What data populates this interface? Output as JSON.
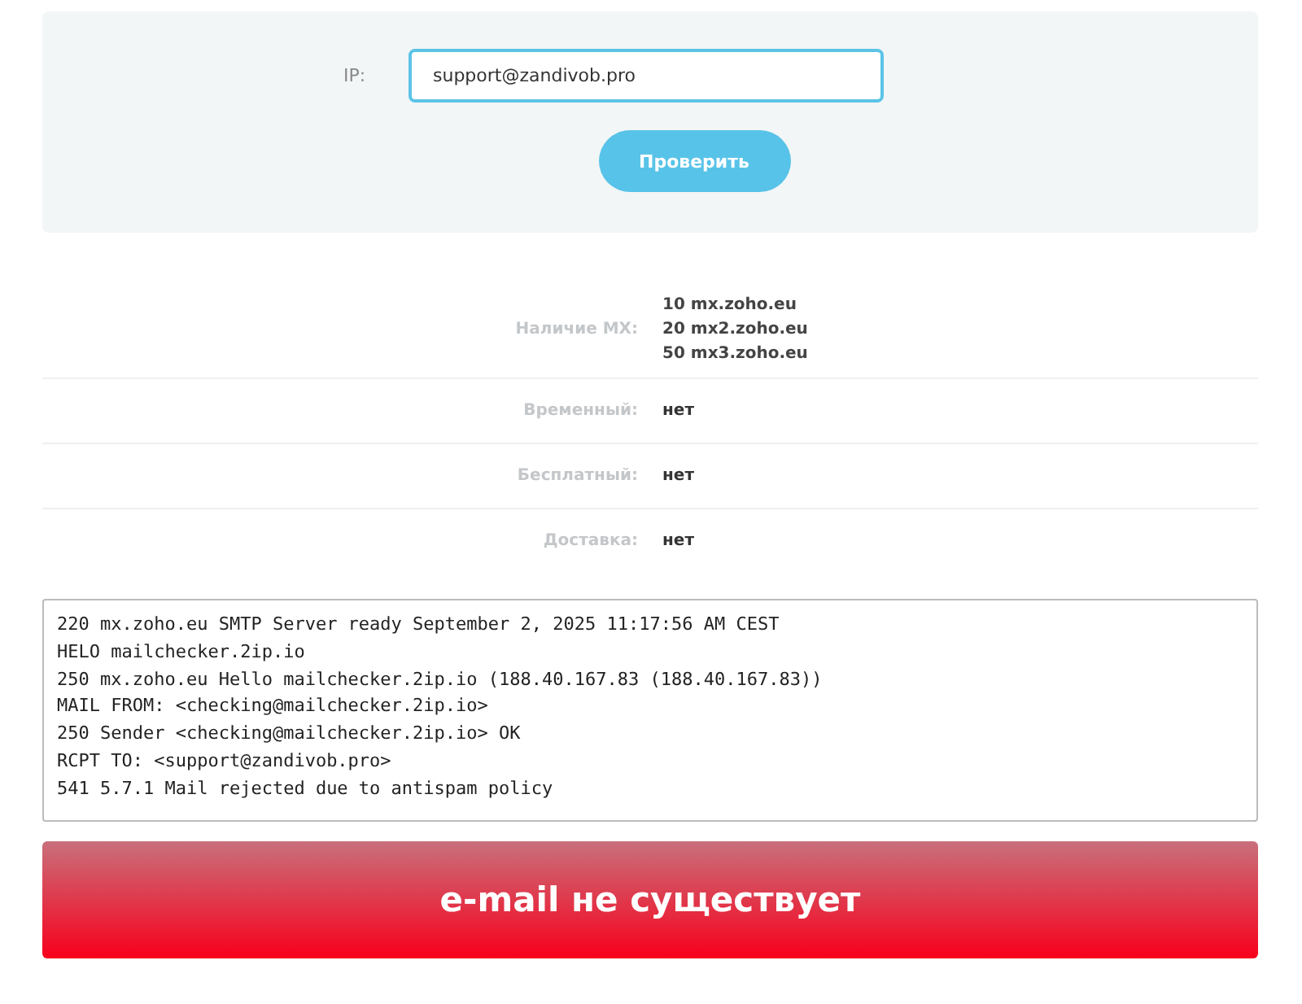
{
  "form": {
    "label": "IP:",
    "value": "support@zandivob.pro",
    "button": "Проверить"
  },
  "results": [
    {
      "label": "Наличие MX:",
      "values": [
        "**10** mx.zoho.eu",
        "**20** mx2.zoho.eu",
        "**50** mx3.zoho.eu"
      ]
    },
    {
      "label": "Временный:",
      "values": [
        "нет"
      ]
    },
    {
      "label": "Бесплатный:",
      "values": [
        "нет"
      ]
    },
    {
      "label": "Доставка:",
      "values": [
        "нет"
      ]
    }
  ],
  "log": [
    "220 mx.zoho.eu SMTP Server ready September 2, 2025 11:17:56 AM CEST",
    "HELO mailchecker.2ip.io",
    "250 mx.zoho.eu Hello mailchecker.2ip.io (188.40.167.83 (188.40.167.83))",
    "MAIL FROM: <checking@mailchecker.2ip.io>",
    "250 Sender <checking@mailchecker.2ip.io> OK",
    "RCPT TO: <support@zandivob.pro>",
    "541 5.7.1 Mail rejected due to antispam policy"
  ],
  "verdict": {
    "ok": false,
    "text": "e-mail не существует"
  }
}
